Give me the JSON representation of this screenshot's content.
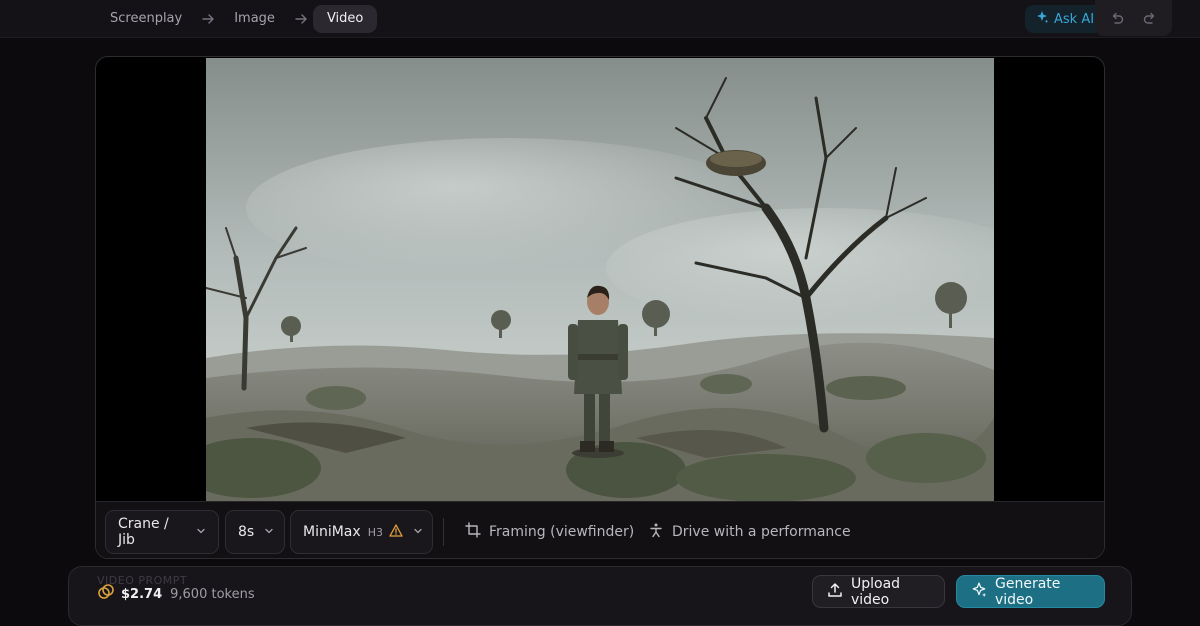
{
  "breadcrumbs": [
    "Screenplay",
    "Image",
    "Video"
  ],
  "active_crumb": "Video",
  "ask_ai_label": "Ask AI",
  "controls": {
    "camera_move": "Crane / Jib",
    "duration": "8s",
    "model": "MiniMax",
    "model_variant": "H3",
    "framing_label": "Framing (viewfinder)",
    "performance_label": "Drive with a performance"
  },
  "footer": {
    "section_label": "VIDEO PROMPT",
    "cost": "$2.74",
    "tokens": "9,600 tokens",
    "upload_label": "Upload video",
    "generate_label": "Generate video"
  },
  "colors": {
    "accent": "#1d6f83",
    "ask_ai": "#3aa6d6",
    "warning": "#e6a23c",
    "coin": "#d9a23a"
  }
}
